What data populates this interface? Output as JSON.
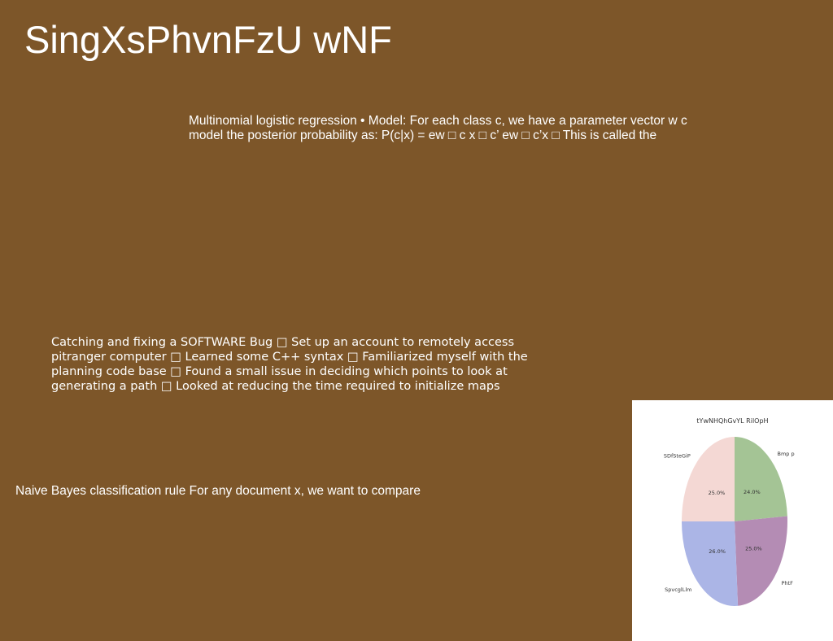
{
  "slide": {
    "background": "#7d5629",
    "title": "SingXsPhvnFzU wNF",
    "blocks": [
      {
        "lines": [
          "Multinomial logistic regression • Model: For each class c, we have a parameter vector w c",
          "model the posterior probability as: P(c|x) = ew □ c x □ c’ ew □ c’x □ This is called the"
        ]
      },
      {
        "lines": [
          "Catching and fixing a SOFTWARE Bug □ Set up an account to remotely access",
          "pitranger computer □ Learned some C++ syntax □ Familiarized myself with the",
          "planning code base □ Found a small issue in deciding which points to look at",
          "generating a path □ Looked at reducing the time required to initialize maps"
        ]
      },
      {
        "lines": [
          "Naive Bayes classification rule For any document x, we want to compare"
        ]
      }
    ]
  },
  "chart_data": {
    "type": "pie",
    "title": "tYwNHQhGvYL RilOpH",
    "labels": [
      "Bmp p",
      "PhtF",
      "SpvcglLlm",
      "SDfSteGiP"
    ],
    "values": [
      24.0,
      25.0,
      26.0,
      25.0
    ],
    "value_labels": [
      "24.0%",
      "25.0%",
      "26.0%",
      "25.0%"
    ],
    "colors": [
      "#a4c495",
      "#b48cb4",
      "#abb5e6",
      "#f4d8d4"
    ],
    "start": "top",
    "direction": "clockwise"
  }
}
